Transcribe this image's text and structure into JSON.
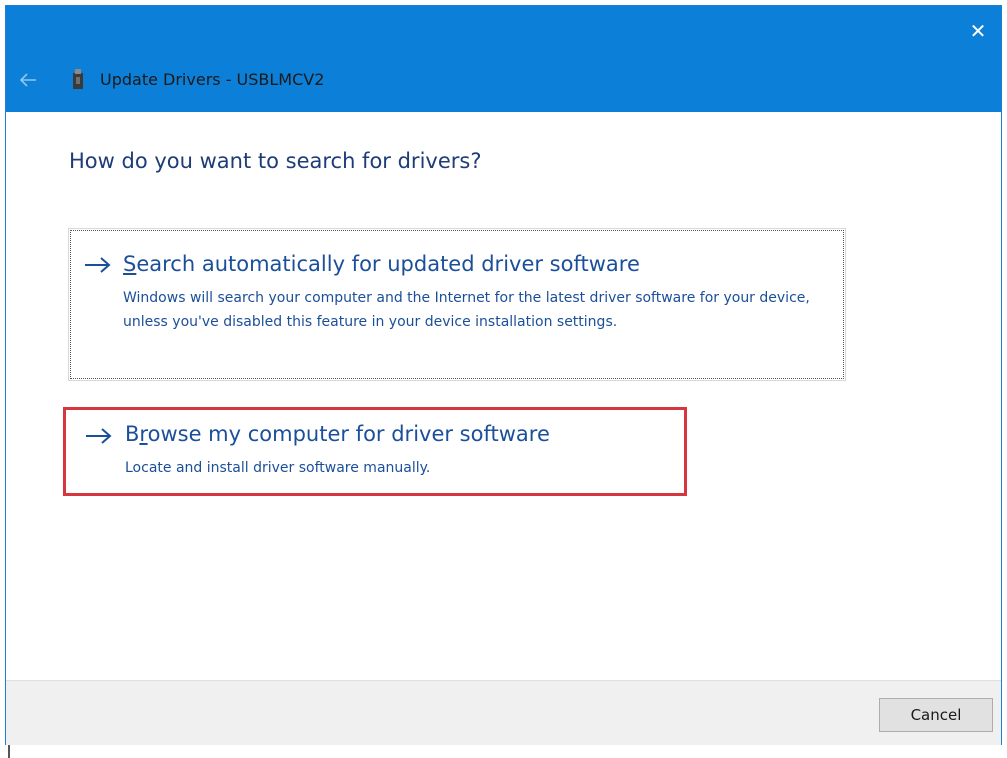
{
  "window": {
    "title": "Update Drivers - USBLMCV2",
    "close_glyph": "✕",
    "accent_color": "#0c7fd8"
  },
  "icons": {
    "back": "back-arrow-icon",
    "device": "usb-device-icon",
    "close": "close-icon",
    "option_arrow": "right-arrow-icon"
  },
  "main": {
    "question": "How do you want to search for drivers?",
    "options": [
      {
        "title_accel": "S",
        "title_rest": "earch automatically for updated driver software",
        "description": "Windows will search your computer and the Internet for the latest driver software for your device, unless you've disabled this feature in your device installation settings."
      },
      {
        "title_first": "B",
        "title_accel": "r",
        "title_rest": "owse my computer for driver software",
        "description": "Locate and install driver software manually.",
        "highlight_color": "#d6373f"
      }
    ]
  },
  "footer": {
    "cancel_label": "Cancel"
  }
}
